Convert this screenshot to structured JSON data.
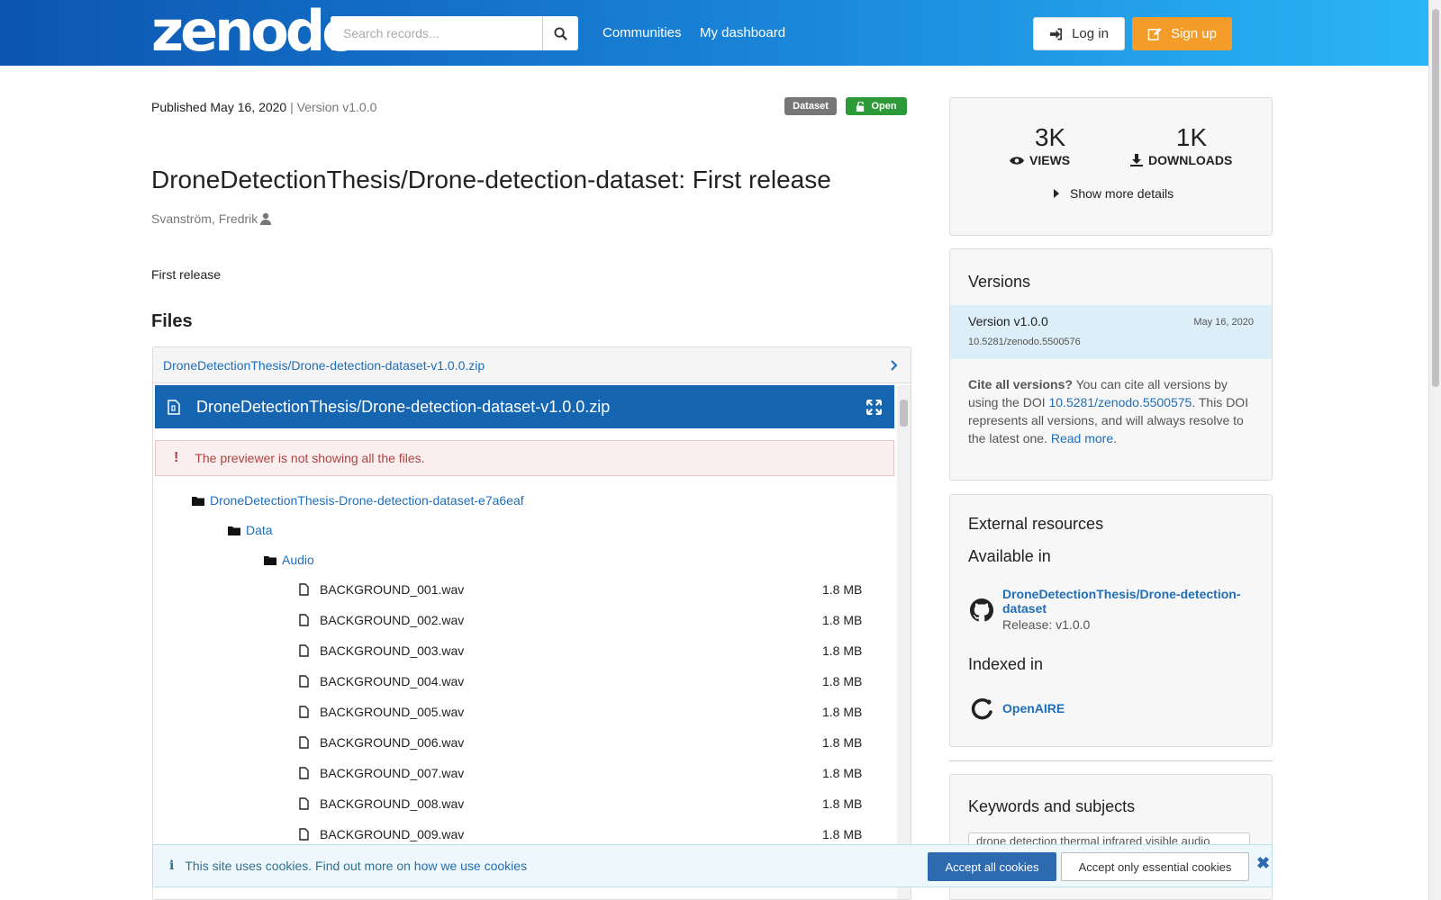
{
  "header": {
    "logo": "zenodo",
    "search_placeholder": "Search records...",
    "nav": [
      "Communities",
      "My dashboard"
    ],
    "login_label": "Log in",
    "signup_label": "Sign up"
  },
  "record": {
    "published_label": "Published May 16, 2020",
    "separator": " | ",
    "version_label": "Version v1.0.0",
    "badge_type": "Dataset",
    "badge_access": "Open",
    "title": "DroneDetectionThesis/Drone-detection-dataset: First release",
    "author": "Svanström, Fredrik",
    "description": "First release"
  },
  "files": {
    "heading": "Files",
    "zip_link": "DroneDetectionThesis/Drone-detection-dataset-v1.0.0.zip",
    "preview_title": "DroneDetectionThesis/Drone-detection-dataset-v1.0.0.zip",
    "alert": "The previewer is not showing all the files.",
    "folders": [
      "DroneDetectionThesis-Drone-detection-dataset-e7a6eaf",
      "Data",
      "Audio"
    ],
    "items": [
      {
        "name": "BACKGROUND_001.wav",
        "size": "1.8 MB"
      },
      {
        "name": "BACKGROUND_002.wav",
        "size": "1.8 MB"
      },
      {
        "name": "BACKGROUND_003.wav",
        "size": "1.8 MB"
      },
      {
        "name": "BACKGROUND_004.wav",
        "size": "1.8 MB"
      },
      {
        "name": "BACKGROUND_005.wav",
        "size": "1.8 MB"
      },
      {
        "name": "BACKGROUND_006.wav",
        "size": "1.8 MB"
      },
      {
        "name": "BACKGROUND_007.wav",
        "size": "1.8 MB"
      },
      {
        "name": "BACKGROUND_008.wav",
        "size": "1.8 MB"
      },
      {
        "name": "BACKGROUND_009.wav",
        "size": "1.8 MB"
      }
    ]
  },
  "stats": {
    "views_count": "3K",
    "views_label": "VIEWS",
    "downloads_count": "1K",
    "downloads_label": "DOWNLOADS",
    "more_details": "Show more details"
  },
  "versions": {
    "heading": "Versions",
    "current_label": "Version v1.0.0",
    "current_date": "May 16, 2020",
    "current_doi": "10.5281/zenodo.5500576",
    "cite_bold": "Cite all versions?",
    "cite_text_1": " You can cite all versions by using the DOI ",
    "cite_doi": "10.5281/zenodo.5500575",
    "cite_text_2": ". This DOI represents all versions, and will always resolve to the latest one. ",
    "read_more": "Read more",
    "period": "."
  },
  "external": {
    "heading": "External resources",
    "available_heading": "Available in",
    "github_link": "DroneDetectionThesis/Drone-detection-dataset",
    "github_release": "Release: v1.0.0",
    "indexed_heading": "Indexed in",
    "openaire_link": "OpenAIRE"
  },
  "keywords": {
    "heading": "Keywords and subjects",
    "tag": "drone detection thermal infrared visible audio"
  },
  "cookie": {
    "text": "This site uses cookies. Find out more on ",
    "link": "how we use cookies",
    "accept_all": "Accept all cookies",
    "accept_essential": "Accept only essential cookies"
  },
  "colors": {
    "header_gradient_start": "#0c55b0",
    "header_gradient_end": "#29b6f6",
    "preview_bar": "#1565b0",
    "signup": "#f39c2a",
    "open_badge": "#2d9a3a",
    "link": "#1f6eb8"
  }
}
